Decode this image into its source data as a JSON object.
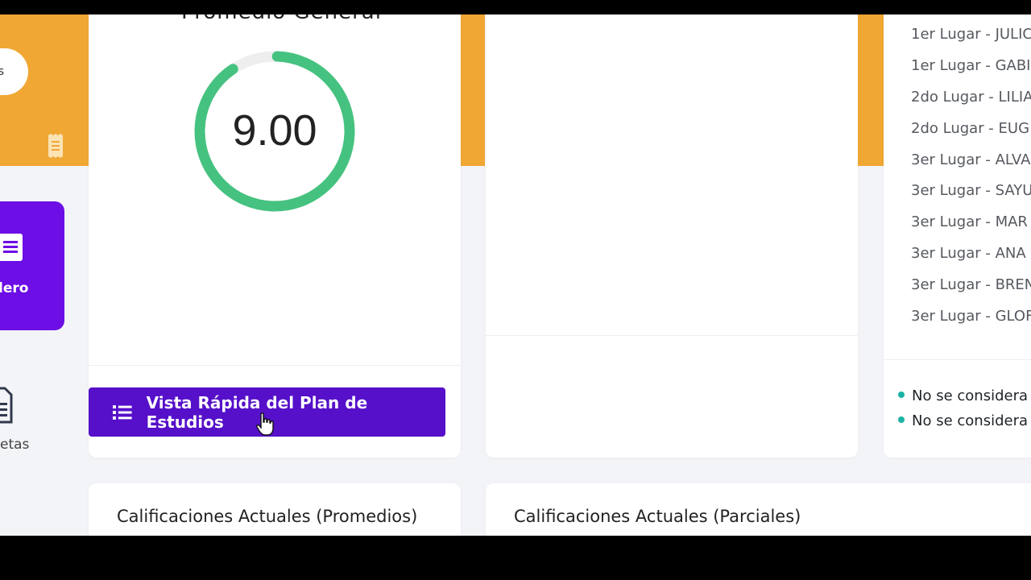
{
  "left_panel": {
    "pill_text": "s",
    "tile_label": "lero",
    "bottom_label": "etas"
  },
  "promedio_card": {
    "title": "Promedio General",
    "value": "9.00",
    "gauge_fraction": 0.9,
    "gauge_color": "#45c27f",
    "button_label": "Vista Rápida del Plan de Estudios"
  },
  "ranking": [
    "1er Lugar - JULIC",
    "1er Lugar - GABI",
    "2do Lugar - LILIA",
    "2do Lugar - EUG",
    "3er Lugar - ALVA",
    "3er Lugar - SAYU",
    "3er Lugar - MAR",
    "3er Lugar - ANA",
    "3er Lugar - BREN",
    "3er Lugar - GLOF"
  ],
  "notes": [
    "No se considera",
    "No se considera"
  ],
  "sections": {
    "promedios_title": "Calificaciones Actuales (Promedios)",
    "parciales_title": "Calificaciones Actuales (Parciales)"
  },
  "colors": {
    "accent_orange": "#f0a733",
    "purple_tile": "#6c0ee5",
    "button_purple": "#5610c9",
    "note_dot": "#1bb3a4"
  }
}
